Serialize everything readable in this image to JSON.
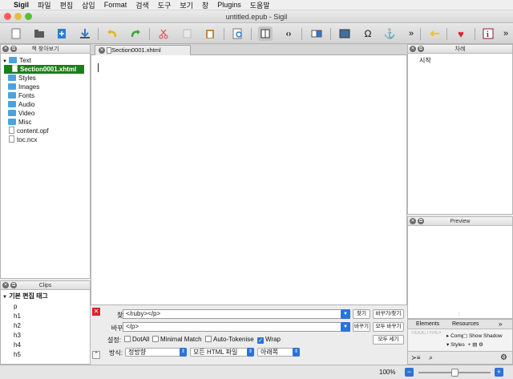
{
  "menubar": {
    "apple": "",
    "items": [
      "Sigil",
      "파일",
      "편집",
      "삽입",
      "Format",
      "검색",
      "도구",
      "보기",
      "창",
      "Plugins",
      "도움말"
    ]
  },
  "window": {
    "title": "untitled.epub - Sigil"
  },
  "traffic": {
    "close": "#fc5b57",
    "min": "#e5bf3c",
    "zoom": "#57c038"
  },
  "toolbar": {
    "icons": [
      "new-file-icon",
      "open-folder-icon",
      "add-file-icon",
      "save-icon",
      "undo-icon",
      "redo-icon",
      "cut-icon",
      "copy-icon",
      "paste-icon",
      "preview-icon",
      "book-view-icon",
      "code-view-icon",
      "split-view-icon",
      "insert-image-icon",
      "omega-icon",
      "anchor-icon",
      "overflow-icon",
      "back-arrow-icon",
      "heart-icon",
      "metadata-icon",
      "overflow-icon"
    ],
    "more": "»"
  },
  "book_browser": {
    "title": "책 찾아보기",
    "items": [
      {
        "label": "Text",
        "type": "folder",
        "expanded": true
      },
      {
        "label": "Section0001.xhtml",
        "type": "file",
        "selected": true
      },
      {
        "label": "Styles",
        "type": "folder"
      },
      {
        "label": "Images",
        "type": "folder"
      },
      {
        "label": "Fonts",
        "type": "folder"
      },
      {
        "label": "Audio",
        "type": "folder"
      },
      {
        "label": "Video",
        "type": "folder"
      },
      {
        "label": "Misc",
        "type": "folder"
      },
      {
        "label": "content.opf",
        "type": "file"
      },
      {
        "label": "toc.ncx",
        "type": "file"
      }
    ]
  },
  "clips": {
    "title": "Clips",
    "group": "기본 편집 태그",
    "items": [
      "p",
      "h1",
      "h2",
      "h3",
      "h4",
      "h5"
    ]
  },
  "editor": {
    "tab": "Section0001.xhtml"
  },
  "toc": {
    "title": "차례",
    "item": "시작"
  },
  "preview": {
    "title": "Preview"
  },
  "inspector": {
    "tabs": [
      "Elements",
      "Resources"
    ],
    "more": "»",
    "node": "<!DOCTYPE>",
    "computed": "Computed Style",
    "styles": "Styles",
    "show_shadow": "Show Shadow"
  },
  "find": {
    "find_label": "찾기:",
    "find_value": "</ruby></p>",
    "replace_label": "바꾸기:",
    "replace_value": "</p>",
    "options_label": "설정:",
    "dotall": "DotAll",
    "minimal": "Minimal Match",
    "autotoken": "Auto-Tokenise",
    "wrap": "Wrap",
    "mode_label": "방식:",
    "mode": "정방향",
    "scope": "모든 HTML 파일",
    "direction": "아래쪽",
    "btn_find": "찾기",
    "btn_replace_find": "바꾸기/찾기",
    "btn_replace": "바꾸기",
    "btn_replace_all": "모두 바꾸기",
    "btn_count": "모두 세기"
  },
  "status": {
    "zoom": "100%",
    "minus": "−",
    "plus": "+"
  }
}
